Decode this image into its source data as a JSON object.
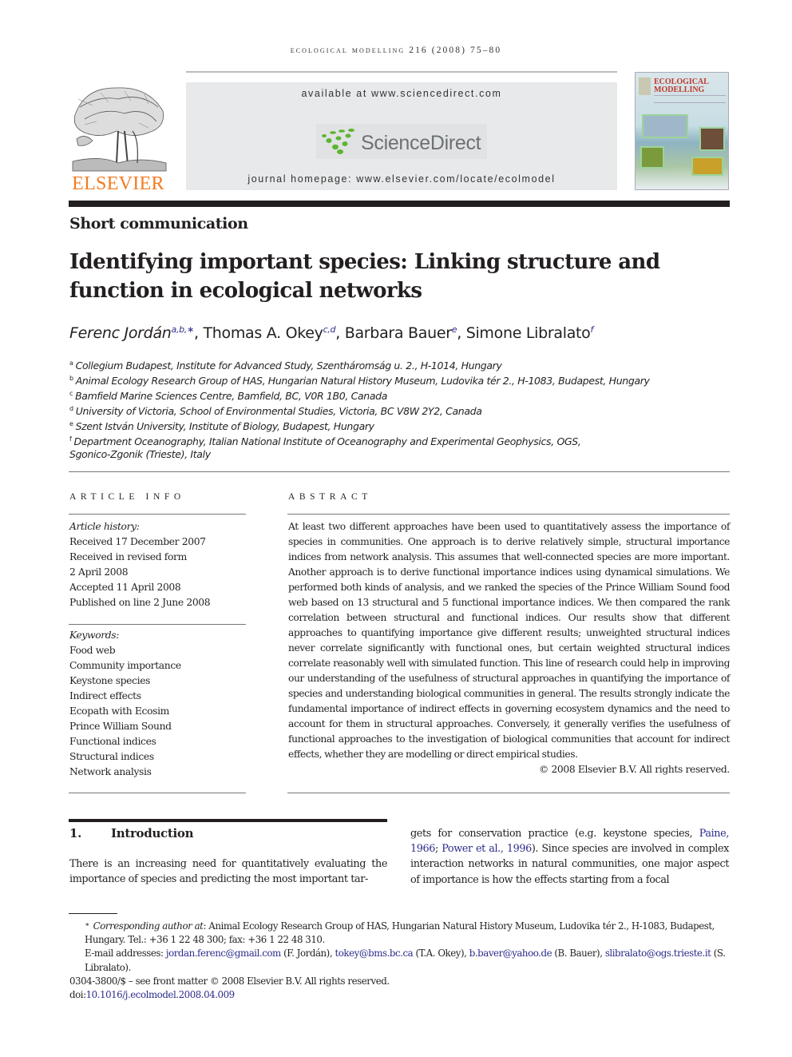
{
  "running_head": "ecological modelling 216 (2008) 75–80",
  "header": {
    "publisher": "ELSEVIER",
    "available_at": "available at www.sciencedirect.com",
    "platform_name": "ScienceDirect",
    "journal_homepage": "journal homepage: www.elsevier.com/locate/ecolmodel",
    "cover": {
      "title_line1": "ECOLOGICAL",
      "title_line2": "MODELLING"
    },
    "colors": {
      "publisher_orange": "#f47b20",
      "sd_green": "#5cb531",
      "link_blue": "#2b2b8c"
    }
  },
  "article": {
    "type": "Short communication",
    "title": "Identifying important species: Linking structure and function in ecological networks",
    "authors": [
      {
        "name": "Ferenc Jordán",
        "marks": "a,b,∗",
        "sep": ", "
      },
      {
        "name": "Thomas A. Okey",
        "marks": "c,d",
        "sep": ", "
      },
      {
        "name": "Barbara Bauer",
        "marks": "e",
        "sep": ", "
      },
      {
        "name": "Simone Libralato",
        "marks": "f",
        "sep": ""
      }
    ],
    "affiliations": [
      {
        "key": "a",
        "text": "Collegium Budapest, Institute for Advanced Study, Szentháromság u. 2., H-1014, Hungary"
      },
      {
        "key": "b",
        "text": "Animal Ecology Research Group of HAS, Hungarian Natural History Museum, Ludovika tér 2., H-1083, Budapest, Hungary"
      },
      {
        "key": "c",
        "text": "Bamfield Marine Sciences Centre, Bamfield, BC, V0R 1B0, Canada"
      },
      {
        "key": "d",
        "text": "University of Victoria, School of Environmental Studies, Victoria, BC V8W 2Y2, Canada"
      },
      {
        "key": "e",
        "text": "Szent István University, Institute of Biology, Budapest, Hungary"
      },
      {
        "key": "f",
        "text": "Department Oceanography, Italian National Institute of Oceanography and Experimental Geophysics, OGS,"
      },
      {
        "key": "",
        "text": "Sgonico-Zgonik (Trieste), Italy"
      }
    ]
  },
  "article_info": {
    "heading": "article info",
    "history_label": "Article history:",
    "history": [
      "Received 17 December 2007",
      "Received in revised form",
      "2 April 2008",
      "Accepted 11 April 2008",
      "Published on line 2 June 2008"
    ],
    "keywords_label": "Keywords:",
    "keywords": [
      "Food web",
      "Community importance",
      "Keystone species",
      "Indirect effects",
      "Ecopath with Ecosim",
      "Prince William Sound",
      "Functional indices",
      "Structural indices",
      "Network analysis"
    ]
  },
  "abstract": {
    "heading": "abstract",
    "text": "At least two different approaches have been used to quantitatively assess the importance of species in communities. One approach is to derive relatively simple, structural importance indices from network analysis. This assumes that well-connected species are more important. Another approach is to derive functional importance indices using dynamical simulations. We performed both kinds of analysis, and we ranked the species of the Prince William Sound food web based on 13 structural and 5 functional importance indices. We then compared the rank correlation between structural and functional indices. Our results show that different approaches to quantifying importance give different results; unweighted structural indices never correlate significantly with functional ones, but certain weighted structural indices correlate reasonably well with simulated function. This line of research could help in improving our understanding of the usefulness of structural approaches in quantifying the importance of species and understanding biological communities in general. The results strongly indicate the fundamental importance of indirect effects in governing ecosystem dynamics and the need to account for them in structural approaches. Conversely, it generally verifies the usefulness of functional approaches to the investigation of biological communities that account for indirect effects, whether they are modelling or direct empirical studies.",
    "copyright": "© 2008 Elsevier B.V. All rights reserved."
  },
  "introduction": {
    "number": "1.",
    "heading": "Introduction",
    "left_text": "There is an increasing need for quantitatively evaluating the importance of species and predicting the most important tar-",
    "right_pre": "gets for conservation practice (e.g. keystone species, ",
    "ref1": "Paine, 1966",
    "ref_sep": "; ",
    "ref2": "Power et al., 1996",
    "right_post": "). Since species are involved in complex interaction networks in natural communities, one major aspect of importance is how the effects starting from a focal"
  },
  "footnotes": {
    "corresponding_label": "Corresponding author at",
    "corresponding_text": ": Animal Ecology Research Group of HAS, Hungarian Natural History Museum, Ludovika tér 2., H-1083, Budapest, Hungary. Tel.: +36 1 22 48 300; fax: +36 1 22 48 310.",
    "email_label": "E-mail addresses: ",
    "emails": [
      {
        "address": "jordan.ferenc@gmail.com",
        "who": " (F. Jordán), "
      },
      {
        "address": "tokey@bms.bc.ca",
        "who": " (T.A. Okey), "
      },
      {
        "address": "b.baver@yahoo.de",
        "who": " (B. Bauer), "
      },
      {
        "address": "slibralato@ogs.trieste.it",
        "who": " (S. Libralato)."
      }
    ],
    "front_matter": "0304-3800/$ – see front matter © 2008 Elsevier B.V. All rights reserved.",
    "doi_label": "doi:",
    "doi": "10.1016/j.ecolmodel.2008.04.009"
  }
}
